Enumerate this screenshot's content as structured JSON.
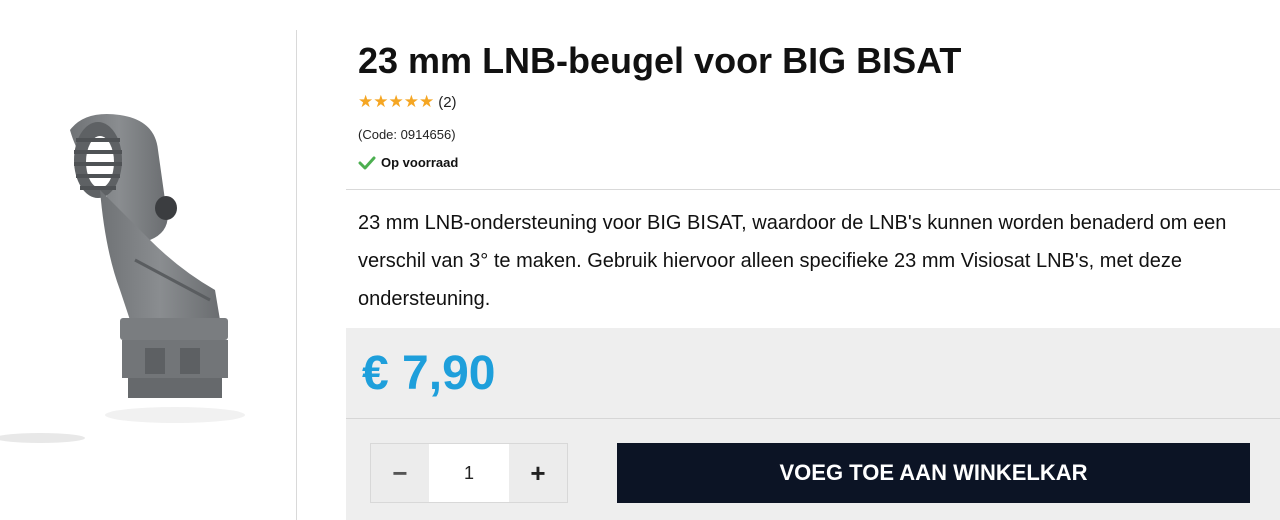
{
  "product": {
    "title": "23 mm LNB-beugel voor BIG BISAT",
    "stars": "★★★★★",
    "review_count": "(2)",
    "code": "(Code: 0914656)",
    "stock_label": "Op voorraad",
    "description": "23 mm LNB-ondersteuning voor BIG BISAT, waardoor de LNB's kunnen worden benaderd om een verschil van 3° te maken. Gebruik hiervoor alleen specifieke 23 mm Visiosat LNB's, met deze ondersteuning.",
    "rating_value": 5
  },
  "purchase": {
    "price": "€ 7,90",
    "qty_minus": "−",
    "qty_plus": "+",
    "qty_value": "1",
    "add_to_cart_label": "VOEG TOE AAN WINKELKAR"
  },
  "colors": {
    "price": "#1e9fdb",
    "stars": "#f5a623",
    "stock_check": "#4caf50",
    "cta_background": "#0c1425"
  },
  "icons": {
    "stock": "check-icon",
    "rating": "star-icon"
  }
}
